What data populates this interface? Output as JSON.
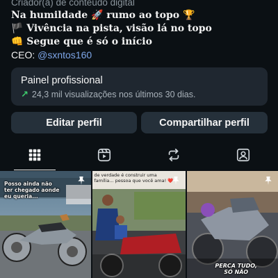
{
  "bio": {
    "category": "Criador(a) de conteúdo digital",
    "line1": "Na humildade 🚀 rumo ao topo 🏆",
    "line2": "🏴 Vivência na pista, visão lá no topo",
    "line3": "👊 Segue que é só o início",
    "ceo_label": "CEO: ",
    "ceo_handle": "@sxntos160"
  },
  "panel": {
    "title": "Painel profissional",
    "subtitle": "24,3 mil visualizações nos últimos 30 dias."
  },
  "buttons": {
    "edit": "Editar perfil",
    "share": "Compartilhar perfil"
  },
  "tabs": [
    {
      "icon": "grid-icon",
      "active": true
    },
    {
      "icon": "reels-icon",
      "active": false
    },
    {
      "icon": "repost-icon",
      "active": false
    },
    {
      "icon": "tagged-icon",
      "active": false
    }
  ],
  "posts": [
    {
      "caption": "Posso ainda não ter chegado aonde eu queria...",
      "pinned": true
    },
    {
      "caption": "de verdade é construir uma família... pessoa que você ama! ❤️",
      "pinned": true
    },
    {
      "caption": "PERCA TUDO, SÓ NÃO",
      "pinned": true
    }
  ],
  "colors": {
    "background": "#0b1014",
    "panel": "#1f2730",
    "button": "#25303a",
    "mention": "#7ea6e8",
    "growth": "#3ecf6e"
  }
}
